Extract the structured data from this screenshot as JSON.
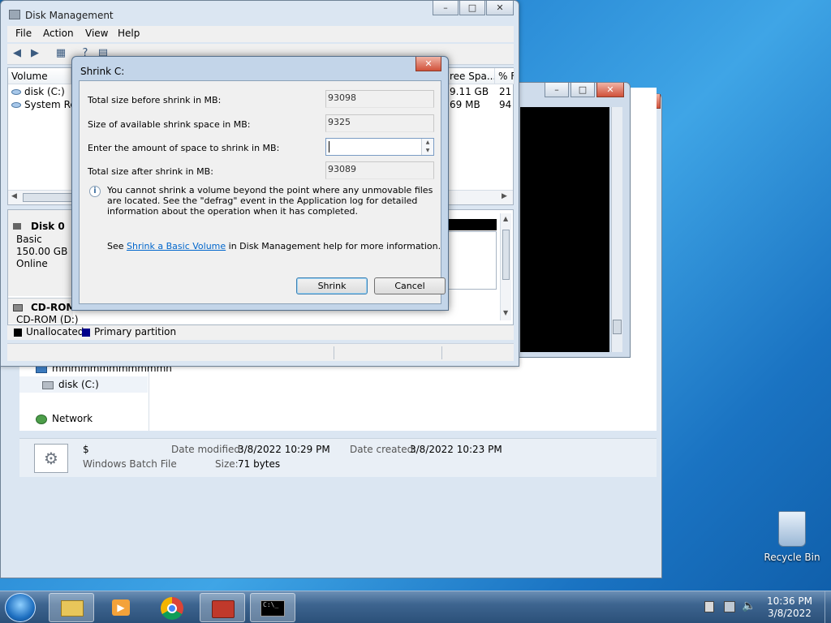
{
  "explorer": {
    "nav_items": [
      "mmmmmmmmmmmmn",
      "disk (C:)",
      "Network"
    ],
    "details": {
      "name": "$",
      "type": "Windows Batch File",
      "date_modified_label": "Date modified:",
      "date_modified": "3/8/2022 10:29 PM",
      "date_created_label": "Date created:",
      "date_created": "3/8/2022 10:23 PM",
      "size_label": "Size:",
      "size": "71 bytes"
    }
  },
  "disk_mgmt": {
    "title": "Disk Management",
    "menu": [
      "File",
      "Action",
      "View",
      "Help"
    ],
    "columns": [
      "Volume",
      "ree Spa...",
      "% F"
    ],
    "volumes": [
      {
        "name": "disk (C:)",
        "free": "9.11 GB",
        "pct": "21"
      },
      {
        "name": "System Res",
        "free": "69 MB",
        "pct": "94"
      }
    ],
    "disk0": {
      "name": "Disk 0",
      "type": "Basic",
      "size": "150.00 GB",
      "status": "Online"
    },
    "cdrom": {
      "name": "CD-ROM 0",
      "drive": "CD-ROM (D:)"
    },
    "legend": {
      "unallocated": "Unallocated",
      "primary": "Primary partition"
    }
  },
  "shrink": {
    "title": "Shrink C:",
    "total_before_label": "Total size before shrink in MB:",
    "total_before": "93098",
    "available_label": "Size of available shrink space in MB:",
    "available": "9325",
    "amount_label": "Enter the amount of space to shrink in MB:",
    "amount_value": "",
    "total_after_label": "Total size after shrink in MB:",
    "total_after": "93089",
    "info": "You cannot shrink a volume beyond the point where any unmovable files are located. See the \"defrag\" event in the Application log for detailed information about the operation when it has completed.",
    "see_prefix": "See ",
    "link": "Shrink a Basic Volume",
    "see_suffix": " in Disk Management help for more information.",
    "shrink_button": "Shrink",
    "cancel_button": "Cancel"
  },
  "desktop": {
    "recycle_bin": "Recycle Bin"
  },
  "taskbar": {
    "time": "10:36 PM",
    "date": "3/8/2022"
  },
  "colors": {
    "cmd_bg": "#000000",
    "primary_partition": "#00008b",
    "link": "#0066cc"
  }
}
